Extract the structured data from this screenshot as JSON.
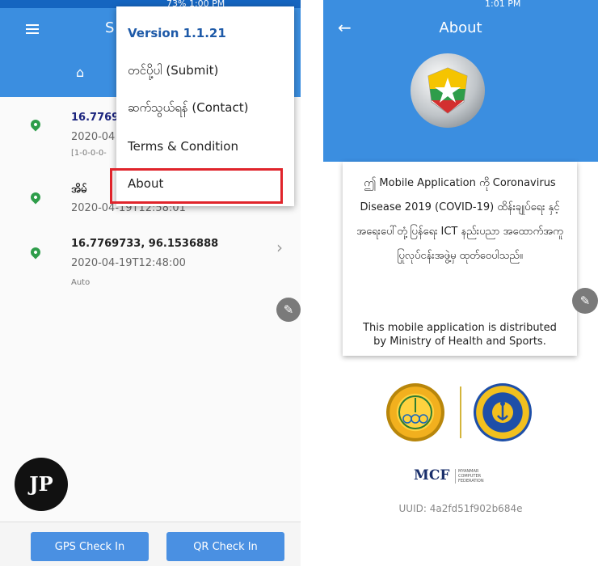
{
  "left_screen": {
    "statusbar": {
      "text": "73% 1:00 PM"
    },
    "appbar": {
      "title_partial": "S"
    },
    "menu": {
      "version": "Version 1.1.21",
      "submit": "တင်ပို့ပါ (Submit)",
      "contact": "ဆက်သွယ်ရန် (Contact)",
      "terms": "Terms & Condition",
      "about": "About"
    },
    "list": [
      {
        "title": "16.7769",
        "time": "2020-04",
        "detail": "[1-0-0-0-"
      },
      {
        "title": "အိမ်",
        "time": "2020-04-19T12:58:01"
      },
      {
        "title": "16.7769733, 96.1536888",
        "time": "2020-04-19T12:48:00",
        "detail": "Auto"
      }
    ],
    "watermark": "JP",
    "buttons": {
      "gps": "GPS Check In",
      "qr": "QR Check In"
    }
  },
  "right_screen": {
    "statusbar": {
      "text": "1:01 PM"
    },
    "title": "About",
    "card_my": "ဤ Mobile Application ကို Coronavirus Disease 2019 (COVID-19) ထိန်းချုပ်ရေး နှင့် အရေးပေါ်တုံ့ပြန်ရေး ICT နည်းပညာ အထောက်အကူပြုလုပ်ငန်းအဖွဲ့မှ ထုတ်ဝေပါသည်။",
    "card_en": "This mobile application is distributed by Ministry of Health and Sports.",
    "mcf": "MCF",
    "mcf_sub": "MYANMAR COMPUTER FEDERATION",
    "uuid": "UUID: 4a2fd51f902b684e"
  },
  "colors": {
    "primary": "#3b8ee0",
    "pin": "#2e9d4a",
    "highlight": "#e0242b",
    "button": "#4a90e2"
  }
}
